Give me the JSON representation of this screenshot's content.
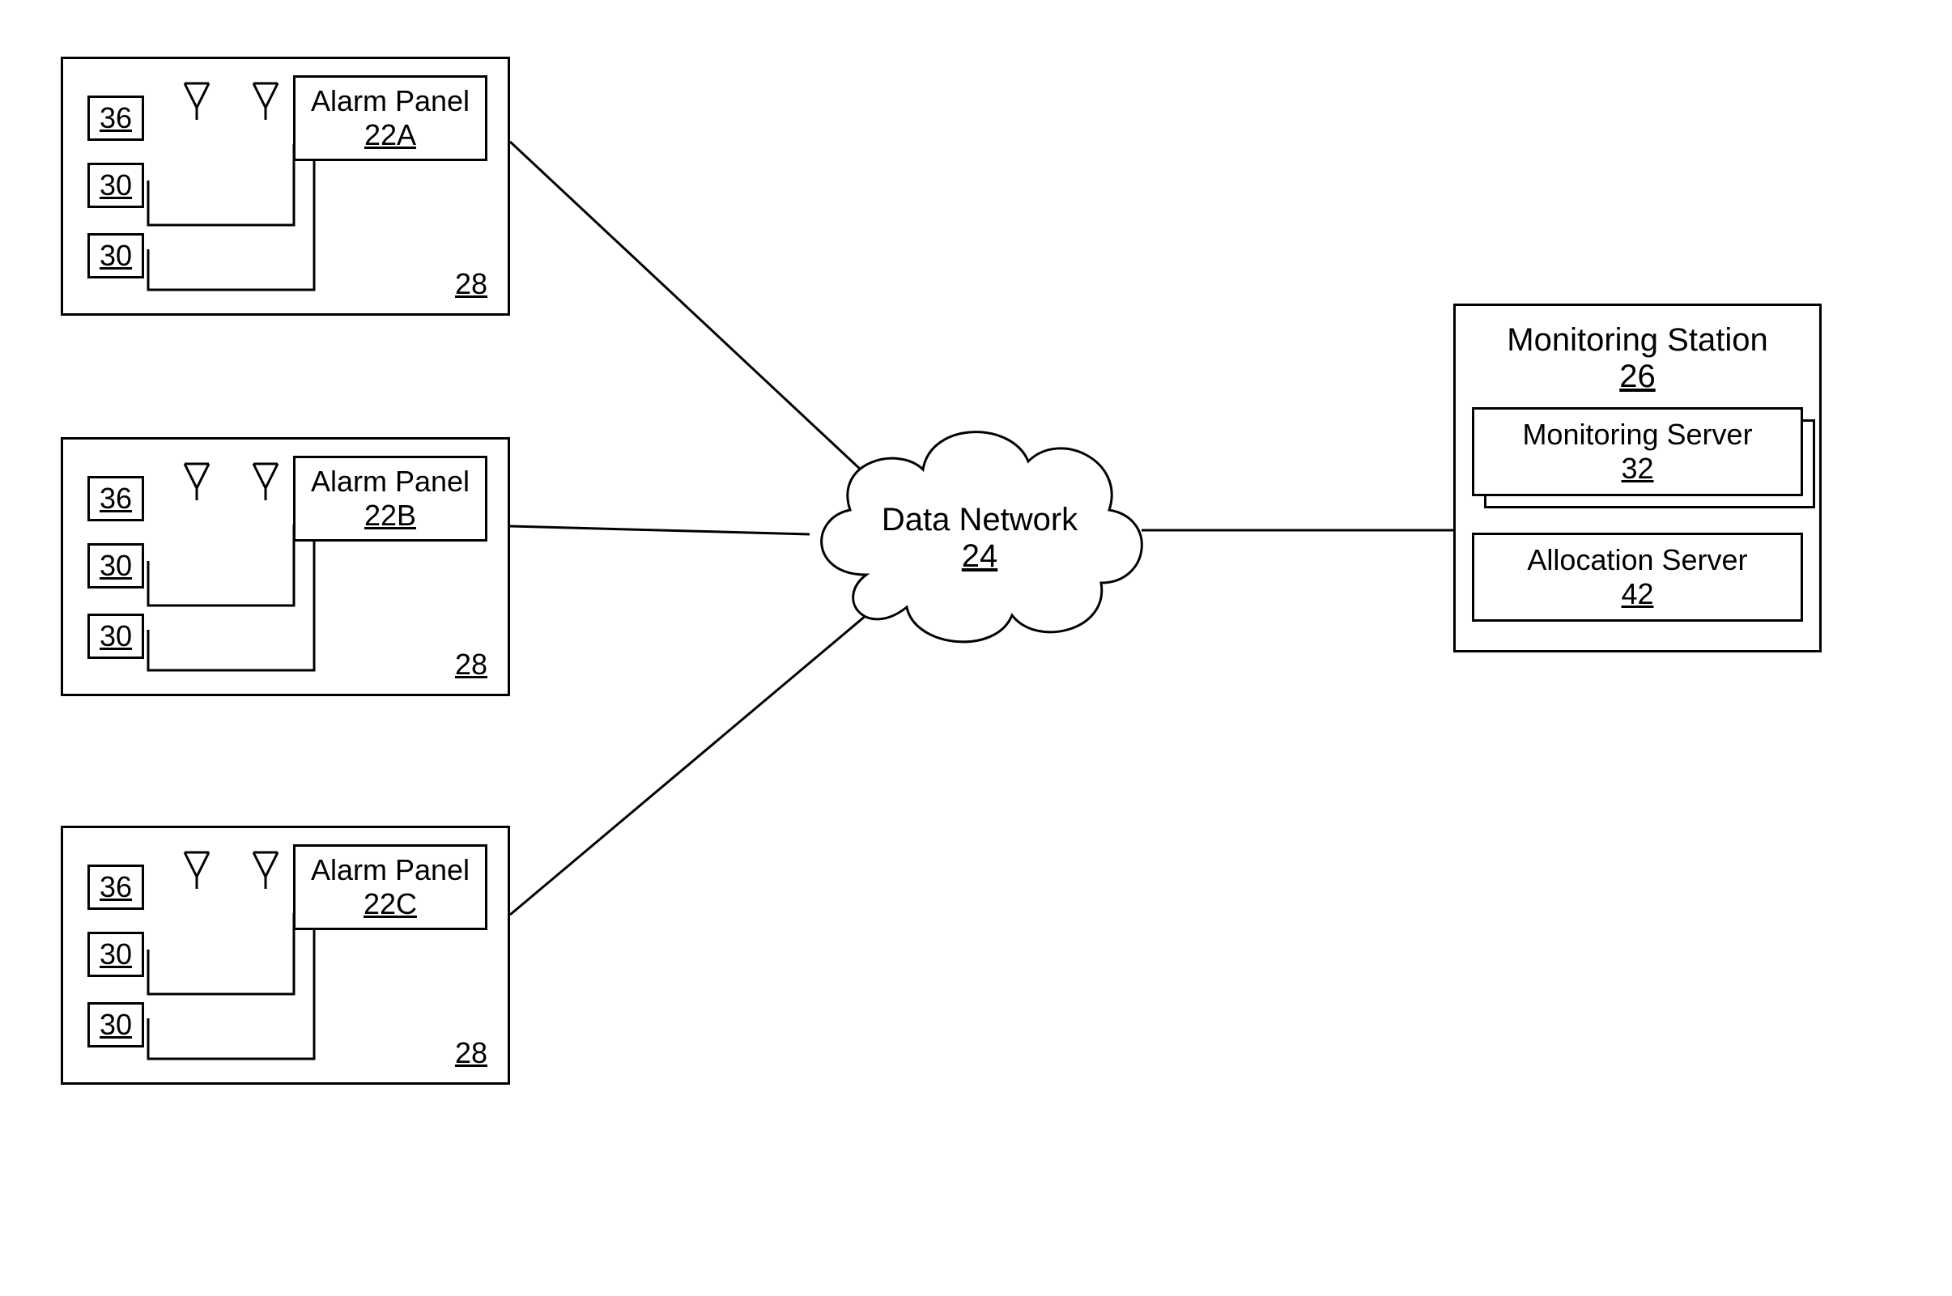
{
  "premises": [
    {
      "id": "A",
      "alarm_panel_label": "Alarm Panel",
      "alarm_panel_ref": "22A",
      "sensor_wireless_ref": "36",
      "sensor_wired_refs": [
        "30",
        "30"
      ],
      "premise_ref": "28"
    },
    {
      "id": "B",
      "alarm_panel_label": "Alarm Panel",
      "alarm_panel_ref": "22B",
      "sensor_wireless_ref": "36",
      "sensor_wired_refs": [
        "30",
        "30"
      ],
      "premise_ref": "28"
    },
    {
      "id": "C",
      "alarm_panel_label": "Alarm Panel",
      "alarm_panel_ref": "22C",
      "sensor_wireless_ref": "36",
      "sensor_wired_refs": [
        "30",
        "30"
      ],
      "premise_ref": "28"
    }
  ],
  "network": {
    "label": "Data Network",
    "ref": "24"
  },
  "monitoring_station": {
    "label": "Monitoring Station",
    "ref": "26",
    "monitoring_server_label": "Monitoring Server",
    "monitoring_server_ref": "32",
    "allocation_server_label": "Allocation Server",
    "allocation_server_ref": "42"
  }
}
